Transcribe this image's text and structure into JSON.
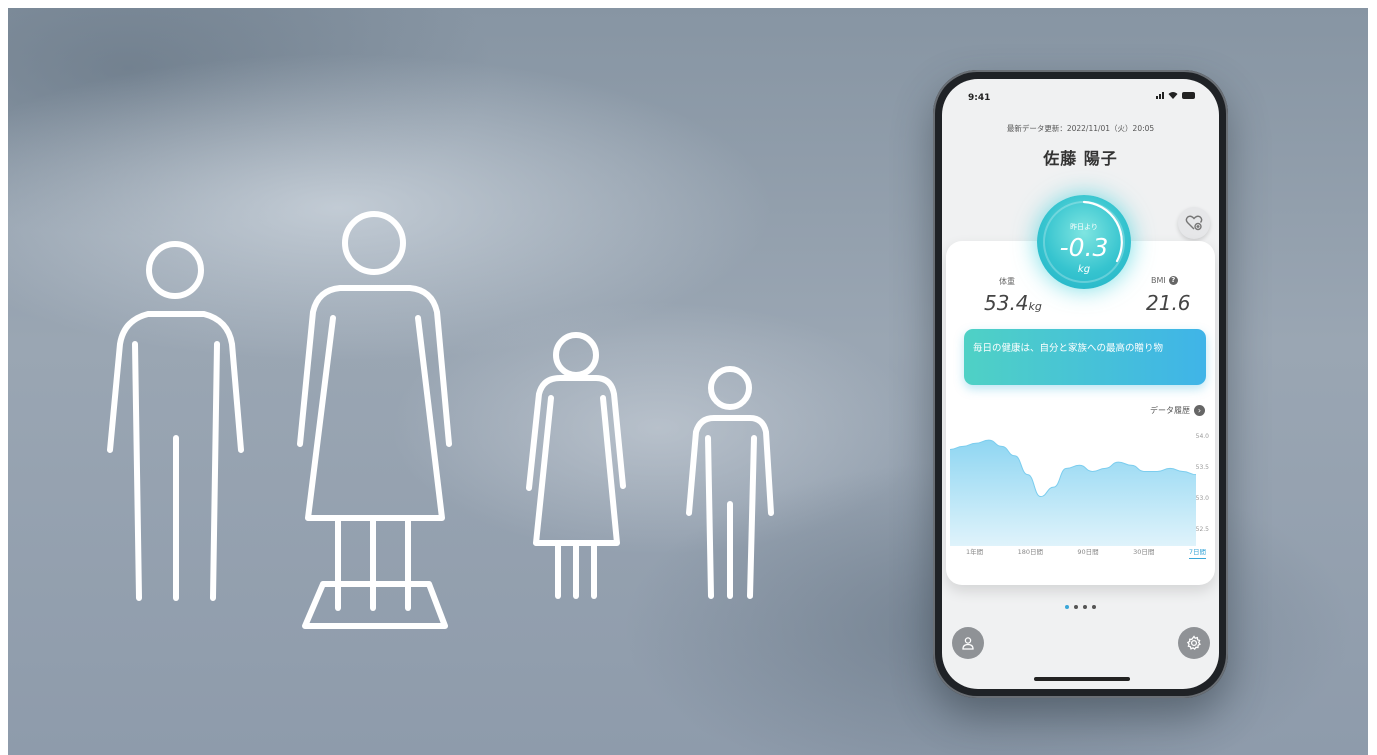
{
  "phone": {
    "status_bar": {
      "time": "9:41"
    },
    "last_update": "最新データ更新：2022/11/01（火）20:05",
    "user_name": "佐藤 陽子",
    "delta": {
      "label": "昨日より",
      "value": "-0.3",
      "unit": "kg"
    },
    "weight": {
      "label": "体重",
      "value": "53.4",
      "unit": "kg"
    },
    "bmi": {
      "label": "BMI",
      "value": "21.6"
    },
    "message": "毎日の健康は、自分と家族への最高の贈り物",
    "history_link": "データ履歴",
    "chart": {
      "y_ticks": [
        "54.0",
        "53.5",
        "53.0",
        "52.5"
      ],
      "range_tabs": [
        "1年間",
        "180日間",
        "90日間",
        "30日間",
        "7日間"
      ],
      "active_tab": "7日間"
    },
    "page_indicator": {
      "count": 4,
      "active": 0
    }
  },
  "colors": {
    "accent_teal": "#36c4cf",
    "accent_blue": "#3aa6d8",
    "background_gray": "#9aa6b3"
  },
  "icons": [
    "heart-plus-icon",
    "help-icon",
    "arrow-right-icon",
    "profile-icon",
    "gear-icon"
  ],
  "chart_data": {
    "type": "area",
    "x": [
      1,
      2,
      3,
      4,
      5,
      6,
      7,
      8,
      9,
      10,
      11,
      12,
      13,
      14,
      15,
      16,
      17,
      18,
      19,
      20
    ],
    "y": [
      53.8,
      53.85,
      53.9,
      53.95,
      53.85,
      53.7,
      53.4,
      53.05,
      53.2,
      53.5,
      53.55,
      53.45,
      53.5,
      53.6,
      53.55,
      53.45,
      53.45,
      53.5,
      53.45,
      53.4
    ],
    "ylim": [
      52.5,
      54.0
    ],
    "y_ticks": [
      54.0,
      53.5,
      53.0,
      52.5
    ],
    "x_tick_labels": [
      "1年間",
      "180日間",
      "90日間",
      "30日間",
      "7日間"
    ],
    "grid": false
  }
}
